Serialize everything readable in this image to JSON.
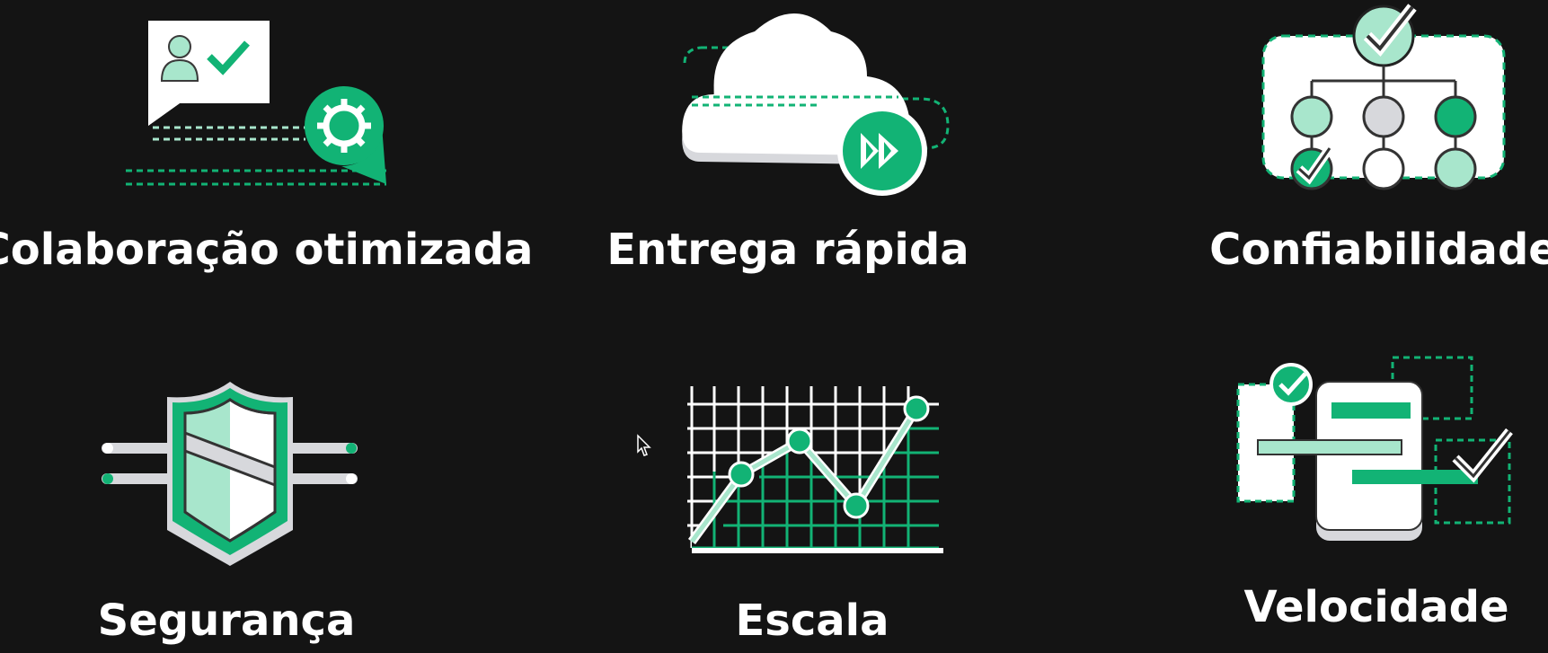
{
  "slide": {
    "features": [
      {
        "label": "Colaboração otimizada",
        "icon": "collaboration-icon"
      },
      {
        "label": "Entrega rápida",
        "icon": "cloud-fast-forward-icon"
      },
      {
        "label": "Confiabilidade",
        "icon": "hierarchy-check-icon"
      },
      {
        "label": "Segurança",
        "icon": "shield-icon"
      },
      {
        "label": "Escala",
        "icon": "growth-chart-icon"
      },
      {
        "label": "Velocidade",
        "icon": "task-flow-icon"
      }
    ]
  },
  "colors": {
    "background": "#141414",
    "accent": "#12b375",
    "accent_light": "#a8e6cc",
    "white": "#ffffff",
    "gray": "#d7d8dc"
  }
}
